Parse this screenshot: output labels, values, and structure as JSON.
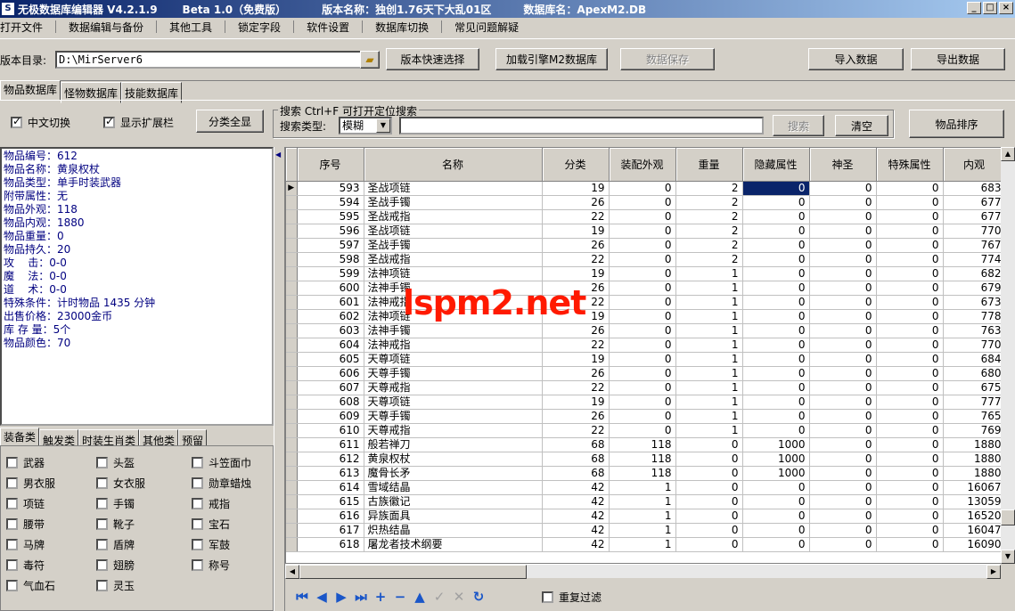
{
  "window": {
    "app": "无极数据库编辑器 V4.2.1.9",
    "beta": "Beta 1.0（免费版）",
    "version_name": "版本名称：独创1.76天下大乱01区",
    "db_name": "数据库名：ApexM2.DB"
  },
  "menu": [
    "打开文件",
    "数据编辑与备份",
    "其他工具",
    "锁定字段",
    "软件设置",
    "数据库切换",
    "常见问题解疑"
  ],
  "toolbar": {
    "dir_label": "版本目录:",
    "dir_value": "D:\\MirServer6",
    "quick_select": "版本快速选择",
    "load_engine": "加载引擎M2数据库",
    "save": "数据保存",
    "import": "导入数据",
    "export": "导出数据"
  },
  "db_tabs": [
    "物品数据库",
    "怪物数据库",
    "技能数据库"
  ],
  "options": {
    "chinese_switch": "中文切换",
    "show_ext": "显示扩展栏",
    "show_all_cats": "分类全显"
  },
  "search": {
    "group_label": "搜索  Ctrl+F 可打开定位搜索",
    "type_label": "搜索类型:",
    "type_value": "模糊",
    "search_btn": "搜索",
    "clear_btn": "清空",
    "sort_btn": "物品排序"
  },
  "info": [
    "物品编号：612",
    "物品名称：黄泉权杖",
    "物品类型：单手时装武器",
    "附带属性：无",
    "物品外观：118",
    "物品内观：1880",
    "物品重量：0",
    "物品持久：20",
    "攻    击：0-0",
    "魔    法：0-0",
    "道    术：0-0",
    "特殊条件：计时物品 1435 分钟",
    "出售价格：23000金币",
    "库 存 量：5个",
    "物品颜色：70"
  ],
  "cat_tabs": [
    "装备类",
    "触发类",
    "时装生肖类",
    "其他类",
    "预留"
  ],
  "categories": [
    "武器",
    "头盔",
    "斗笠面巾",
    "男衣服",
    "女衣服",
    "勋章蜡烛",
    "项链",
    "手镯",
    "戒指",
    "腰带",
    "靴子",
    "宝石",
    "马牌",
    "盾牌",
    "军鼓",
    "毒符",
    "翅膀",
    "称号",
    "气血石",
    "灵玉"
  ],
  "table": {
    "headers": [
      "序号",
      "名称",
      "分类",
      "装配外观",
      "重量",
      "隐藏属性",
      "神圣",
      "特殊属性",
      "内观"
    ],
    "rows": [
      [
        "593",
        "圣战项链",
        "19",
        "0",
        "2",
        "0",
        "0",
        "0",
        "683"
      ],
      [
        "594",
        "圣战手镯",
        "26",
        "0",
        "2",
        "0",
        "0",
        "0",
        "677"
      ],
      [
        "595",
        "圣战戒指",
        "22",
        "0",
        "2",
        "0",
        "0",
        "0",
        "677"
      ],
      [
        "596",
        "圣战项链",
        "19",
        "0",
        "2",
        "0",
        "0",
        "0",
        "770"
      ],
      [
        "597",
        "圣战手镯",
        "26",
        "0",
        "2",
        "0",
        "0",
        "0",
        "767"
      ],
      [
        "598",
        "圣战戒指",
        "22",
        "0",
        "2",
        "0",
        "0",
        "0",
        "774"
      ],
      [
        "599",
        "法神项链",
        "19",
        "0",
        "1",
        "0",
        "0",
        "0",
        "682"
      ],
      [
        "600",
        "法神手镯",
        "26",
        "0",
        "1",
        "0",
        "0",
        "0",
        "679"
      ],
      [
        "601",
        "法神戒指",
        "22",
        "0",
        "1",
        "0",
        "0",
        "0",
        "673"
      ],
      [
        "602",
        "法神项链",
        "19",
        "0",
        "1",
        "0",
        "0",
        "0",
        "778"
      ],
      [
        "603",
        "法神手镯",
        "26",
        "0",
        "1",
        "0",
        "0",
        "0",
        "763"
      ],
      [
        "604",
        "法神戒指",
        "22",
        "0",
        "1",
        "0",
        "0",
        "0",
        "770"
      ],
      [
        "605",
        "天尊项链",
        "19",
        "0",
        "1",
        "0",
        "0",
        "0",
        "684"
      ],
      [
        "606",
        "天尊手镯",
        "26",
        "0",
        "1",
        "0",
        "0",
        "0",
        "680"
      ],
      [
        "607",
        "天尊戒指",
        "22",
        "0",
        "1",
        "0",
        "0",
        "0",
        "675"
      ],
      [
        "608",
        "天尊项链",
        "19",
        "0",
        "1",
        "0",
        "0",
        "0",
        "777"
      ],
      [
        "609",
        "天尊手镯",
        "26",
        "0",
        "1",
        "0",
        "0",
        "0",
        "765"
      ],
      [
        "610",
        "天尊戒指",
        "22",
        "0",
        "1",
        "0",
        "0",
        "0",
        "769"
      ],
      [
        "611",
        "般若禅刀",
        "68",
        "118",
        "0",
        "1000",
        "0",
        "0",
        "1880"
      ],
      [
        "612",
        "黄泉权杖",
        "68",
        "118",
        "0",
        "1000",
        "0",
        "0",
        "1880"
      ],
      [
        "613",
        "魔骨长矛",
        "68",
        "118",
        "0",
        "1000",
        "0",
        "0",
        "1880"
      ],
      [
        "614",
        "雪域结晶",
        "42",
        "1",
        "0",
        "0",
        "0",
        "0",
        "16067"
      ],
      [
        "615",
        "古族徽记",
        "42",
        "1",
        "0",
        "0",
        "0",
        "0",
        "13059"
      ],
      [
        "616",
        "异族面具",
        "42",
        "1",
        "0",
        "0",
        "0",
        "0",
        "16520"
      ],
      [
        "617",
        "炽热结晶",
        "42",
        "1",
        "0",
        "0",
        "0",
        "0",
        "16047"
      ],
      [
        "618",
        "屠龙者技术纲要",
        "42",
        "1",
        "0",
        "0",
        "0",
        "0",
        "16090"
      ]
    ]
  },
  "watermark": "lspm2.net",
  "footer": {
    "dedupe": "重复过滤",
    "nav_icons": [
      "first-icon",
      "prior-icon",
      "next-icon",
      "last-icon",
      "insert-icon",
      "delete-icon",
      "edit-icon",
      "post-icon",
      "cancel-icon",
      "refresh-icon"
    ]
  }
}
